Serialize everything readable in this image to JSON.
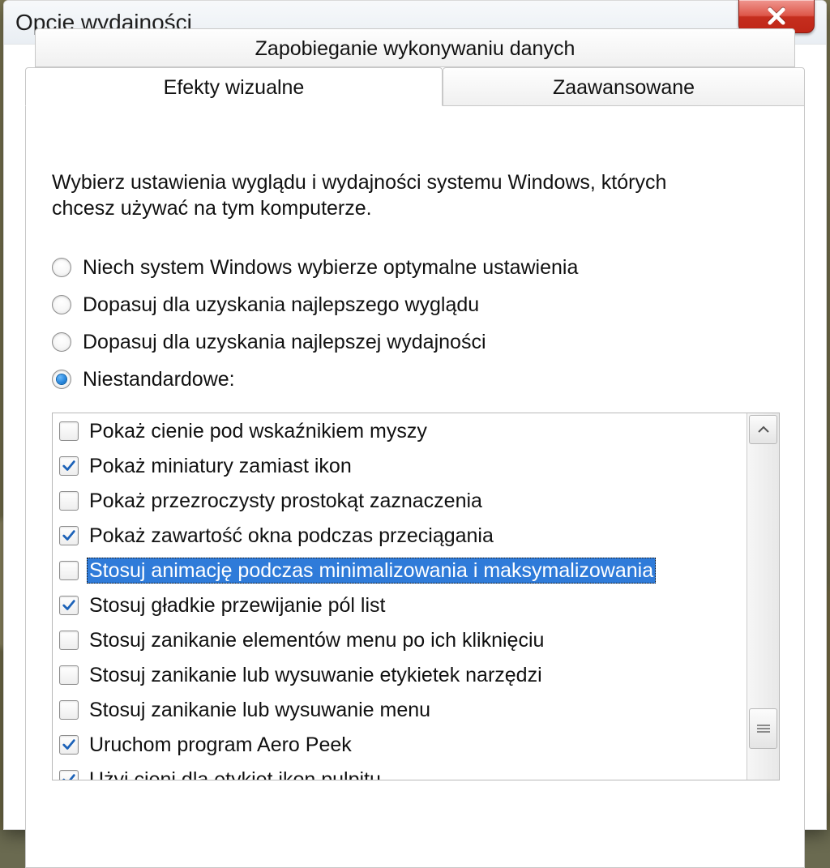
{
  "window": {
    "title": "Opcje wydajności"
  },
  "tabs": {
    "dep": "Zapobieganie wykonywaniu danych",
    "visual": "Efekty wizualne",
    "advanced": "Zaawansowane",
    "active": "visual"
  },
  "panel": {
    "intro": "Wybierz ustawienia wyglądu i wydajności systemu Windows, których chcesz używać na tym komputerze."
  },
  "radios": {
    "selected": 3,
    "items": [
      "Niech system Windows wybierze optymalne ustawienia",
      "Dopasuj dla uzyskania najlepszego wyglądu",
      "Dopasuj dla uzyskania najlepszej wydajności",
      "Niestandardowe:"
    ]
  },
  "list": {
    "selected": 4,
    "items": [
      {
        "label": "Pokaż cienie pod wskaźnikiem myszy",
        "checked": false
      },
      {
        "label": "Pokaż miniatury zamiast ikon",
        "checked": true
      },
      {
        "label": "Pokaż przezroczysty prostokąt zaznaczenia",
        "checked": false
      },
      {
        "label": "Pokaż zawartość okna podczas przeciągania",
        "checked": true
      },
      {
        "label": "Stosuj animację podczas minimalizowania i maksymalizowania",
        "checked": false
      },
      {
        "label": "Stosuj gładkie przewijanie pól list",
        "checked": true
      },
      {
        "label": "Stosuj zanikanie elementów menu po ich kliknięciu",
        "checked": false
      },
      {
        "label": "Stosuj zanikanie lub wysuwanie etykietek narzędzi",
        "checked": false
      },
      {
        "label": "Stosuj zanikanie lub wysuwanie menu",
        "checked": false
      },
      {
        "label": "Uruchom program Aero Peek",
        "checked": true
      },
      {
        "label": "Użyj cieni dla etykiet ikon pulpitu",
        "checked": true
      }
    ]
  }
}
